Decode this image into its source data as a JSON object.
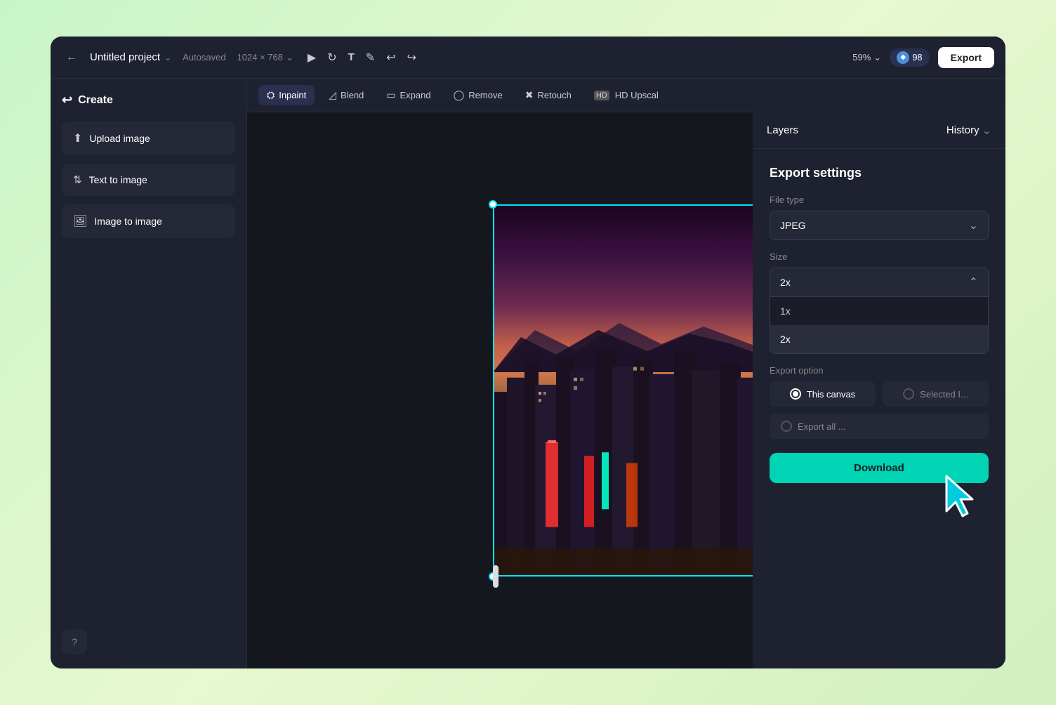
{
  "window": {
    "title": "Untitled project"
  },
  "header": {
    "back_label": "←",
    "project_name": "Untitled project",
    "autosaved": "Autosaved",
    "canvas_size": "1024 × 768",
    "zoom": "59%",
    "credits": "98",
    "export_label": "Export"
  },
  "toolbar": {
    "items": [
      {
        "id": "inpaint",
        "label": "Inpaint",
        "active": true
      },
      {
        "id": "blend",
        "label": "Blend",
        "active": false
      },
      {
        "id": "expand",
        "label": "Expand",
        "active": false
      },
      {
        "id": "remove",
        "label": "Remove",
        "active": false
      },
      {
        "id": "retouch",
        "label": "Retouch",
        "active": false
      },
      {
        "id": "upscal",
        "label": "HD Upscal",
        "active": false
      }
    ]
  },
  "sidebar": {
    "create_label": "Create",
    "items": [
      {
        "id": "upload",
        "label": "Upload image",
        "icon": "⬆"
      },
      {
        "id": "text-to-image",
        "label": "Text to image",
        "icon": "⬆"
      },
      {
        "id": "image-to-image",
        "label": "Image to image",
        "icon": "🖼"
      }
    ],
    "help_icon": "?"
  },
  "right_panel": {
    "tabs": [
      {
        "id": "layers",
        "label": "Layers",
        "active": true
      },
      {
        "id": "history",
        "label": "History",
        "active": false
      }
    ]
  },
  "export_settings": {
    "title": "Export settings",
    "file_type_label": "File type",
    "file_type_value": "JPEG",
    "size_label": "Size",
    "size_value": "2x",
    "size_options": [
      "1x",
      "2x"
    ],
    "export_option_label": "Export option",
    "this_canvas_label": "This canvas",
    "selected_label": "Selected I...",
    "export_all_label": "Export all ...",
    "download_label": "Download"
  }
}
